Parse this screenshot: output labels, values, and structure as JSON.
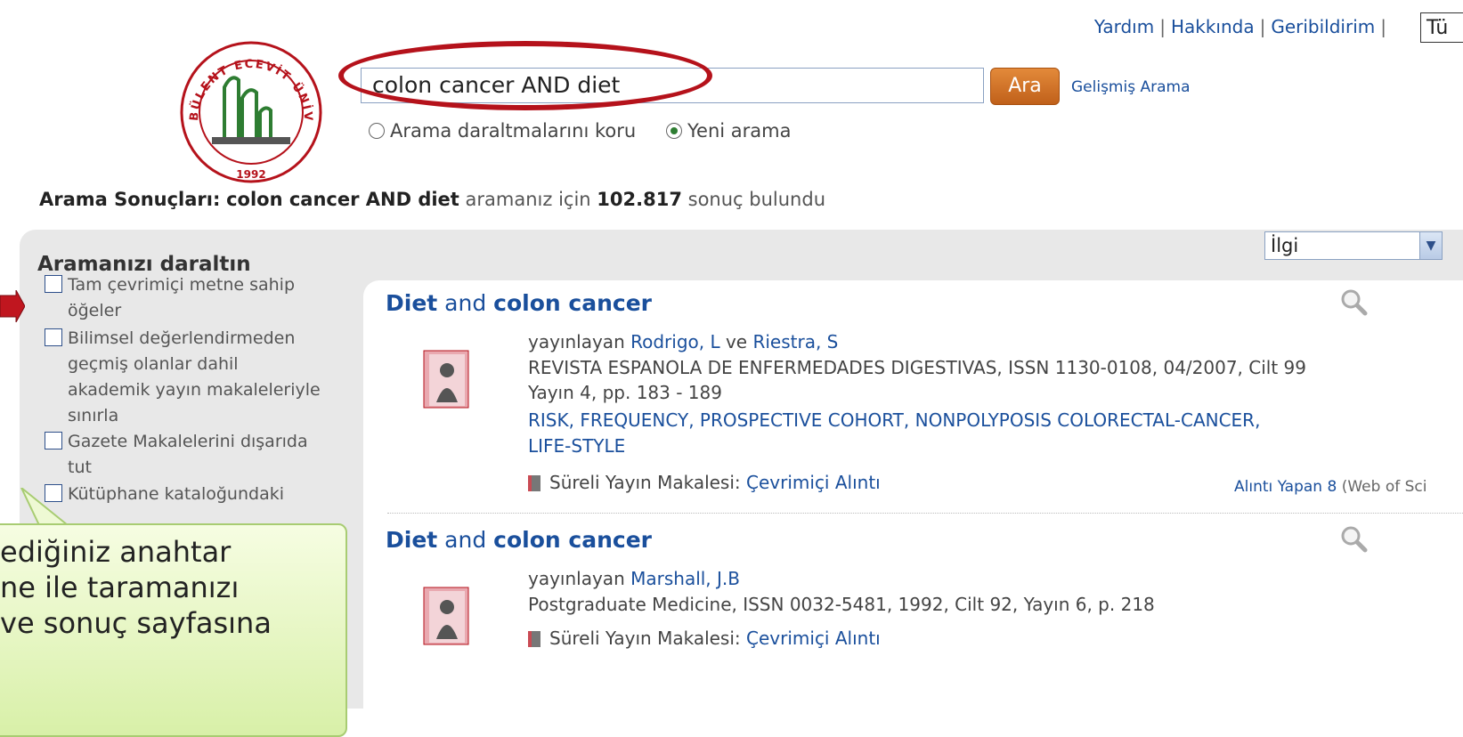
{
  "top_links": [
    "Yardım",
    "Hakkında",
    "Geribildirim"
  ],
  "lang_box": "Tü",
  "logo": {
    "ring_text": "BÜLENT ECEVİT ÜNİVERSİTESİ",
    "year": "1992"
  },
  "search": {
    "query": "colon cancer AND diet",
    "button": "Ara",
    "advanced": "Gelişmiş Arama",
    "option_keep": "Arama daraltmalarını koru",
    "option_new": "Yeni arama"
  },
  "summary": {
    "label": "Arama Sonuçları:",
    "query": "colon cancer AND diet",
    "mid": "aramanız için",
    "count": "102.817",
    "tail": "sonuç bulundu"
  },
  "sidebar": {
    "title": "Aramanızı daraltın",
    "facets": [
      [
        "Tam çevrimiçi metne sahip",
        "öğeler"
      ],
      [
        "Bilimsel değerlendirmeden",
        "geçmiş olanlar dahil",
        "akademik yayın makaleleriyle",
        "sınırla"
      ],
      [
        "Gazete Makalelerini dışarıda",
        "tut"
      ],
      [
        "Kütüphane kataloğundaki"
      ]
    ]
  },
  "sort": {
    "selected": "İlgi"
  },
  "results": [
    {
      "title_parts": [
        "Diet",
        " and ",
        "colon cancer"
      ],
      "by": "yayınlayan",
      "authors": [
        "Rodrigo, L",
        "Riestra, S"
      ],
      "author_joiner": "ve",
      "source_line1": "REVISTA ESPANOLA DE ENFERMEDADES DIGESTIVAS, ISSN 1130-0108, 04/2007, Cilt 99",
      "source_line2": "Yayın 4, pp. 183 - 189",
      "keywords": [
        "RISK",
        "FREQUENCY",
        "PROSPECTIVE COHORT",
        "NONPOLYPOSIS COLORECTAL-CANCER",
        "LIFE-STYLE"
      ],
      "type_label": "Süreli Yayın Makalesi:",
      "type_link": "Çevrimiçi Alıntı",
      "cited_link": "Alıntı Yapan 8",
      "cited_source": "(Web of Sci"
    },
    {
      "title_parts": [
        "Diet",
        " and ",
        "colon cancer"
      ],
      "by": "yayınlayan",
      "authors": [
        "Marshall, J.B"
      ],
      "source_line1": "Postgraduate Medicine, ISSN 0032-5481, 1992, Cilt 92, Yayın 6, p. 218",
      "type_label": "Süreli Yayın Makalesi:",
      "type_link": "Çevrimiçi Alıntı"
    }
  ],
  "callout": {
    "lines": [
      "ediğiniz anahtar",
      "ne ile taramanızı",
      "ve sonuç sayfasına"
    ]
  },
  "colors": {
    "link": "#1a4f9c",
    "highlight_oval": "#b5121b",
    "button": "#d07428",
    "panel": "#e8e8e8",
    "callout": "#e6f6c0"
  }
}
